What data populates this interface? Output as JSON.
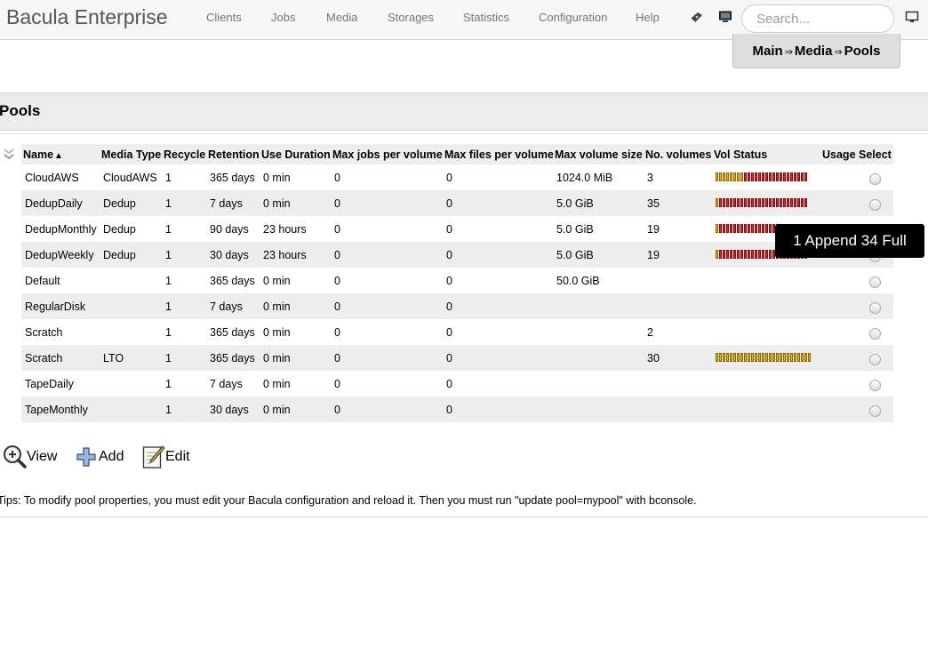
{
  "app": {
    "title": "Bacula Enterprise"
  },
  "nav": {
    "items": [
      {
        "label": "Clients"
      },
      {
        "label": "Jobs"
      },
      {
        "label": "Media"
      },
      {
        "label": "Storages"
      },
      {
        "label": "Statistics"
      },
      {
        "label": "Configuration"
      },
      {
        "label": "Help"
      }
    ],
    "icons": [
      "tape-icon",
      "director-monitor-icon",
      "desktop-icon"
    ]
  },
  "search": {
    "placeholder": "Search..."
  },
  "breadcrumb": {
    "items": [
      "Main",
      "Media",
      "Pools"
    ],
    "separator": "⇒"
  },
  "section": {
    "title": "Pools"
  },
  "table": {
    "headers": [
      "Name",
      "Media Type",
      "Recycle",
      "Retention",
      "Use Duration",
      "Max jobs per volume",
      "Max files per volume",
      "Max volume size",
      "No. volumes",
      "Vol Status",
      "Usage",
      "Select"
    ],
    "sorted_by": "Name",
    "sort_indicator": "▲",
    "rows": [
      {
        "name": "CloudAWS",
        "media_type": "CloudAWS",
        "recycle": "1",
        "retention": "365  days",
        "use_duration": "0 min",
        "max_jobs": "0",
        "max_files": "0",
        "max_size": "1024.0 MiB",
        "volumes": "3",
        "vol_status": {
          "append": 8,
          "full": 18
        }
      },
      {
        "name": "DedupDaily",
        "media_type": "Dedup",
        "recycle": "1",
        "retention": "7 days",
        "use_duration": "0 min",
        "max_jobs": "0",
        "max_files": "0",
        "max_size": "5.0 GiB",
        "volumes": "35",
        "vol_status": {
          "append": 1,
          "full": 25
        }
      },
      {
        "name": "DedupMonthly",
        "media_type": "Dedup",
        "recycle": "1",
        "retention": "90 days",
        "use_duration": "23 hours",
        "max_jobs": "0",
        "max_files": "0",
        "max_size": "5.0 GiB",
        "volumes": "19",
        "vol_status": {
          "append": 1,
          "full": 25
        }
      },
      {
        "name": "DedupWeekly",
        "media_type": "Dedup",
        "recycle": "1",
        "retention": "30 days",
        "use_duration": "23 hours",
        "max_jobs": "0",
        "max_files": "0",
        "max_size": "5.0 GiB",
        "volumes": "19",
        "vol_status": {
          "append": 1,
          "full": 25
        }
      },
      {
        "name": "Default",
        "media_type": "",
        "recycle": "1",
        "retention": "365  days",
        "use_duration": "0 min",
        "max_jobs": "0",
        "max_files": "0",
        "max_size": "50.0 GiB",
        "volumes": "",
        "vol_status": null
      },
      {
        "name": "RegularDisk",
        "media_type": "",
        "recycle": "1",
        "retention": "7 days",
        "use_duration": "0 min",
        "max_jobs": "0",
        "max_files": "0",
        "max_size": "",
        "volumes": "",
        "vol_status": null
      },
      {
        "name": "Scratch",
        "media_type": "",
        "recycle": "1",
        "retention": "365  days",
        "use_duration": "0 min",
        "max_jobs": "0",
        "max_files": "0",
        "max_size": "",
        "volumes": "2",
        "vol_status": null
      },
      {
        "name": "Scratch",
        "media_type": "LTO",
        "recycle": "1",
        "retention": "365  days",
        "use_duration": "0 min",
        "max_jobs": "0",
        "max_files": "0",
        "max_size": "",
        "volumes": "30",
        "vol_status": {
          "append": 27,
          "full": 0
        }
      },
      {
        "name": "TapeDaily",
        "media_type": "",
        "recycle": "1",
        "retention": "7 days",
        "use_duration": "0 min",
        "max_jobs": "0",
        "max_files": "0",
        "max_size": "",
        "volumes": "",
        "vol_status": null
      },
      {
        "name": "TapeMonthly",
        "media_type": "",
        "recycle": "1",
        "retention": "30 days",
        "use_duration": "0 min",
        "max_jobs": "0",
        "max_files": "0",
        "max_size": "",
        "volumes": "",
        "vol_status": null
      }
    ],
    "colors": {
      "append": "#f0b400",
      "full": "#e0202a",
      "row_alt": "#ededed"
    }
  },
  "tooltip": {
    "text": "1 Append 34 Full"
  },
  "actions": [
    {
      "label": "View",
      "icon": "zoom-in-icon"
    },
    {
      "label": "Add",
      "icon": "plus-icon"
    },
    {
      "label": "Edit",
      "icon": "edit-icon"
    }
  ],
  "tips": {
    "text": "Tips: To modify pool properties, you must edit your Bacula configuration and reload it. Then you must run \"update pool=mypool\" with bconsole."
  }
}
